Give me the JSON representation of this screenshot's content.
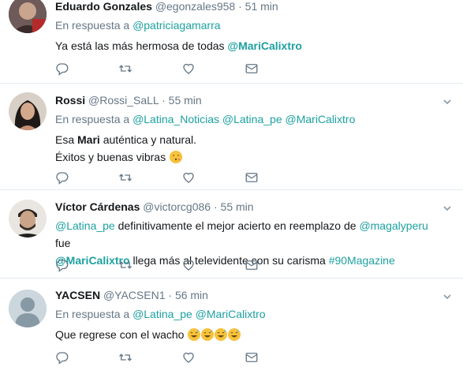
{
  "tweets": [
    {
      "name": "Eduardo Gonzales",
      "handle": "@egonzales958",
      "dot": "·",
      "time": "51 min",
      "reply_prefix": "En respuesta a",
      "reply_to": "@patriciagamarra",
      "text_plain": "Ya está las más hermosa de todas ",
      "text_mention": "@MariCalixtro"
    },
    {
      "name": "Rossi",
      "handle": "@Rossi_SaLL",
      "dot": "·",
      "time": "55 min",
      "reply_prefix": "En respuesta a",
      "reply_to": "@Latina_Noticias @Latina_pe @MariCalixtro",
      "line1_a": "Esa ",
      "line1_bold": "Mari",
      "line1_b": " auténtica y natural.",
      "line2": "Éxitos y buenas vibras "
    },
    {
      "name": "Víctor Cárdenas",
      "handle": "@victorcg086",
      "dot": "·",
      "time": "55 min",
      "m1": "@Latina_pe",
      "t1": " definitivamente el mejor acierto en reemplazo de ",
      "m2": "@magalyperu",
      "t2": " fue",
      "m3": "@MariCalixtro",
      "t3": " llega más al televidente con su carisma ",
      "hashtag": "#90Magazine"
    },
    {
      "name": "YACSEN",
      "handle": "@YACSEN1",
      "dot": "·",
      "time": "56 min",
      "reply_prefix": "En respuesta a",
      "reply_to": "@Latina_pe @MariCalixtro",
      "text_plain": "Que regrese con el wacho "
    }
  ],
  "icons": [
    "reply-icon",
    "retweet-icon",
    "like-icon",
    "direct-message-icon",
    "caret-down-icon"
  ],
  "colors": {
    "link": "#1da1a0",
    "muted": "#657786",
    "border": "#e6ecf0"
  }
}
